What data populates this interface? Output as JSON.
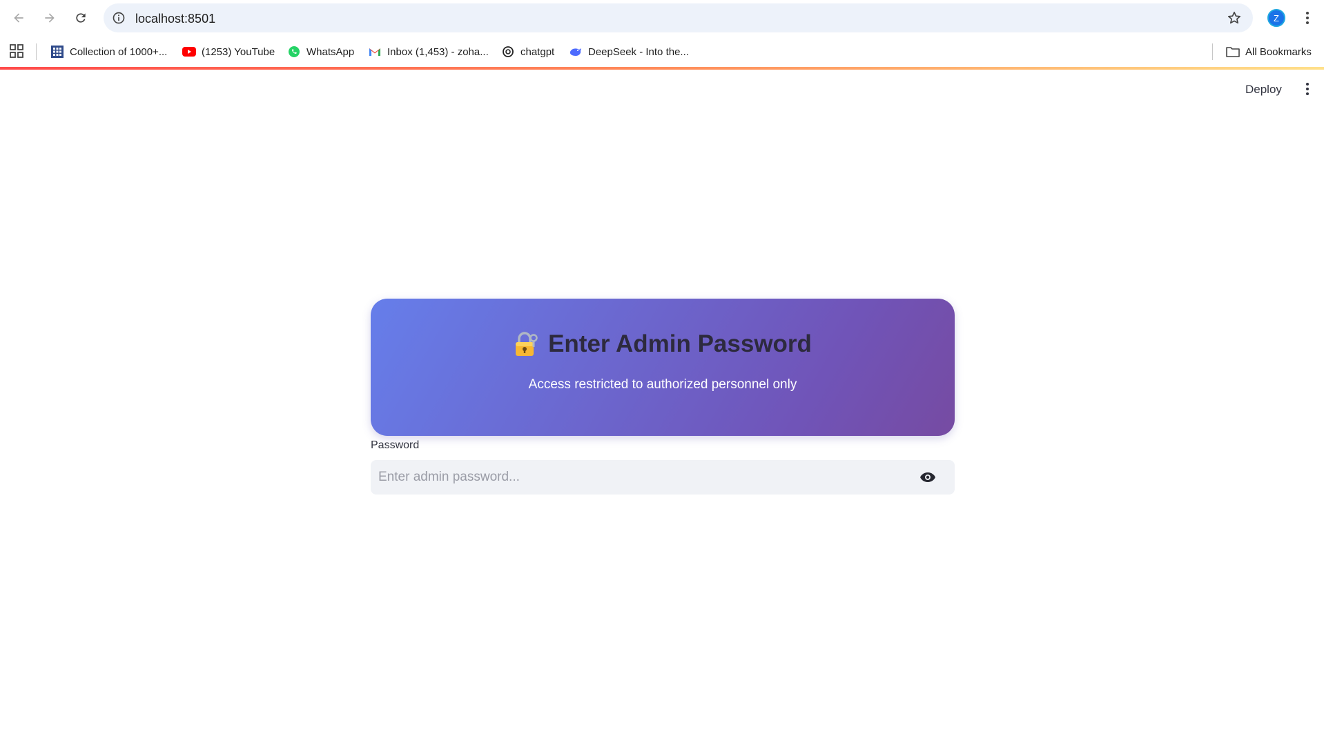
{
  "browser": {
    "url": "localhost:8501",
    "profile_initial": "Z",
    "bookmarks": [
      {
        "label": "Collection of 1000+...",
        "icon": "grid-favicon"
      },
      {
        "label": "(1253) YouTube",
        "icon": "youtube-favicon"
      },
      {
        "label": "WhatsApp",
        "icon": "whatsapp-favicon"
      },
      {
        "label": "Inbox (1,453) - zoha...",
        "icon": "gmail-favicon"
      },
      {
        "label": "chatgpt",
        "icon": "chatgpt-favicon"
      },
      {
        "label": "DeepSeek - Into the...",
        "icon": "deepseek-favicon"
      }
    ],
    "all_bookmarks_label": "All Bookmarks"
  },
  "app": {
    "deploy_label": "Deploy",
    "accent_bar_colors": [
      "#ff4b4b",
      "#ffe08a"
    ]
  },
  "card": {
    "icon": "lock-with-key-icon",
    "title": "Enter Admin Password",
    "subtitle": "Access restricted to authorized personnel only",
    "gradient": [
      "#667eea",
      "#764ba2"
    ]
  },
  "password": {
    "label": "Password",
    "placeholder": "Enter admin password...",
    "value": ""
  }
}
